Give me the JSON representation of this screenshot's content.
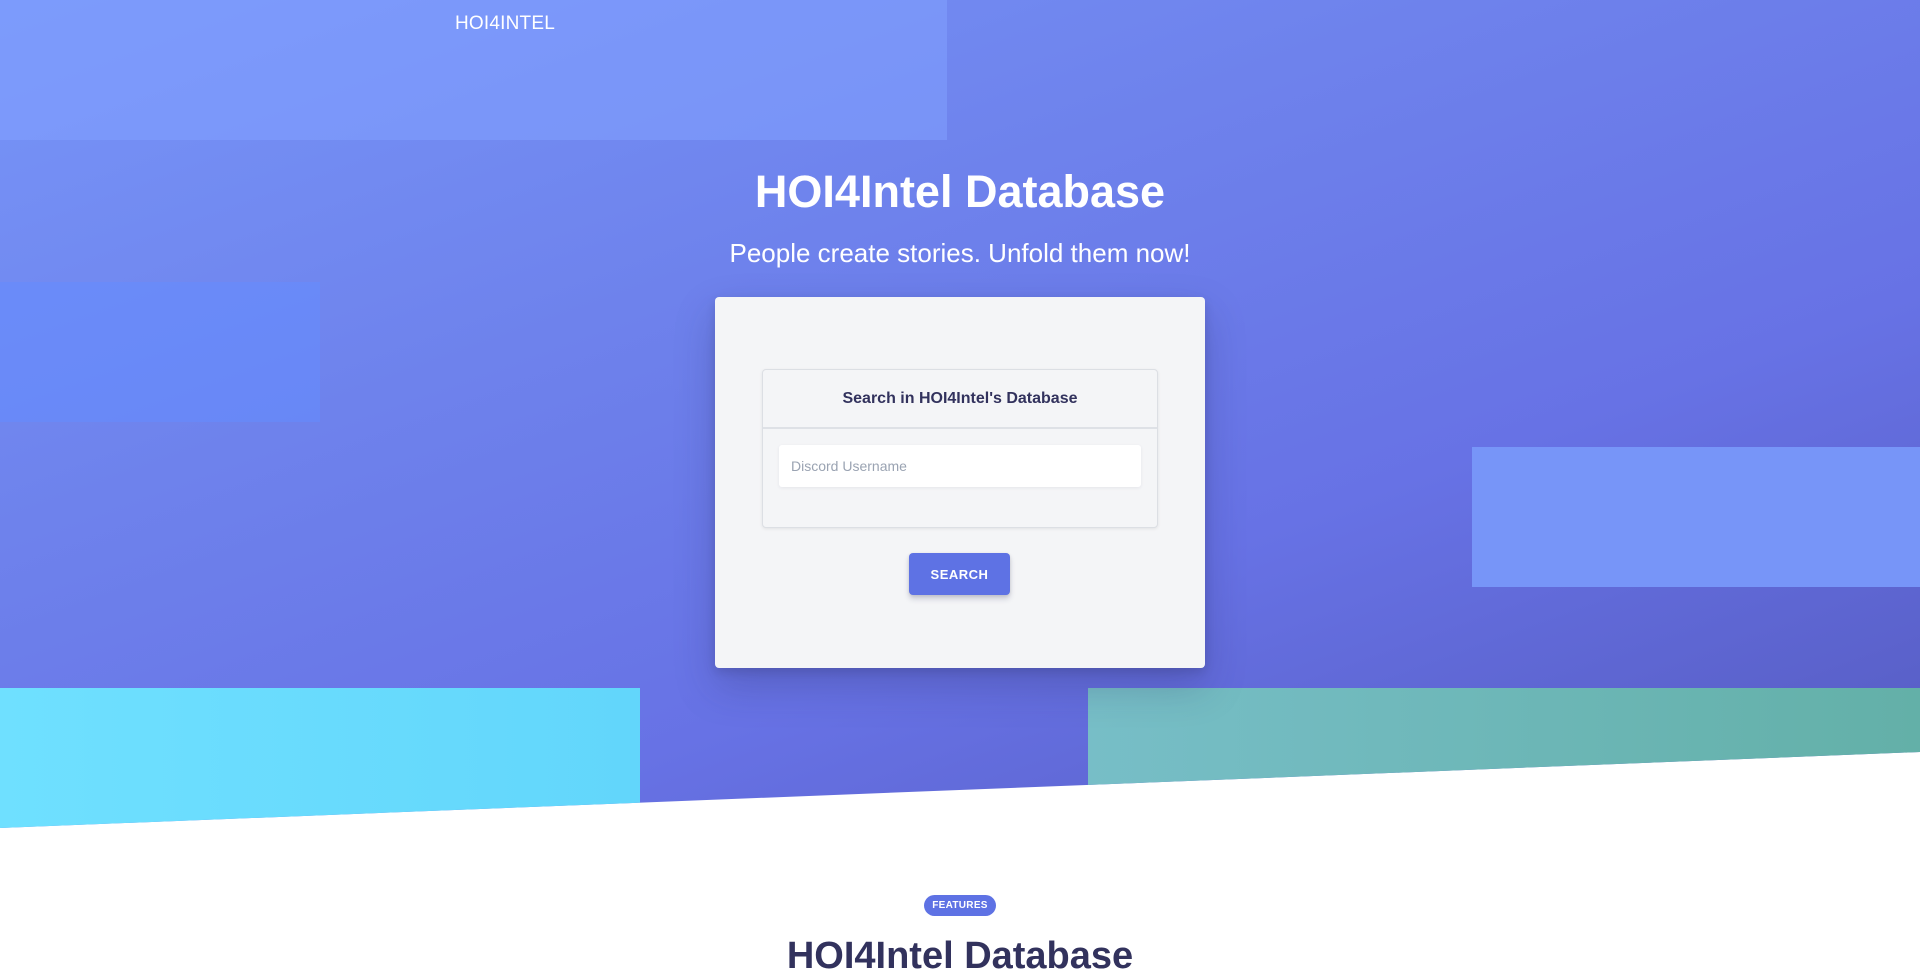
{
  "nav": {
    "brand": "HOI4INTEL"
  },
  "hero": {
    "title": "HOI4Intel Database",
    "subtitle": "People create stories. Unfold them now!"
  },
  "search_card": {
    "heading": "Search in HOI4Intel's Database",
    "input_placeholder": "Discord Username",
    "input_value": "",
    "button_label": "SEARCH"
  },
  "features": {
    "badge": "FEATURES",
    "title": "HOI4Intel Database"
  },
  "colors": {
    "primary": "#5e72e4",
    "hero_gradient_start": "#7795f8",
    "hero_gradient_end": "#555abf",
    "cyan_shape": "#6fe0ff",
    "teal_shape": "#63b0a8"
  }
}
